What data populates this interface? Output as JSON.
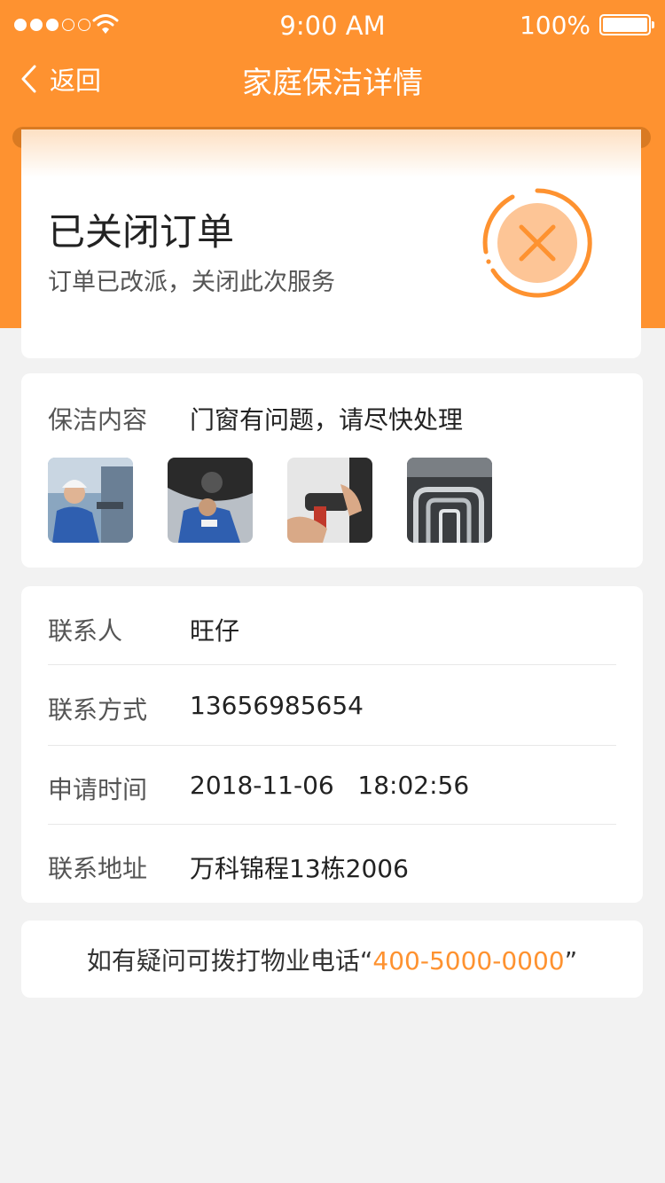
{
  "status_bar": {
    "time": "9:00 AM",
    "battery": "100%"
  },
  "nav": {
    "back_label": "返回",
    "title": "家庭保洁详情"
  },
  "order_status": {
    "title": "已关闭订单",
    "subtitle": "订单已改派，关闭此次服务",
    "icon": "close-icon"
  },
  "cleaning": {
    "label": "保洁内容",
    "value": "门窗有问题，请尽快处理",
    "photos": [
      "worker-photo",
      "car-underside-photo",
      "impact-wrench-photo",
      "pipes-photo"
    ]
  },
  "contact": {
    "rows": [
      {
        "label": "联系人",
        "value": "旺仔"
      },
      {
        "label": "联系方式",
        "value": "13656985654"
      },
      {
        "label": "申请时间",
        "value": "2018-11-06   18:02:56"
      },
      {
        "label": "联系地址",
        "value": "万科锦程13栋2006"
      }
    ]
  },
  "help": {
    "prefix": "如有疑问可拨打物业电话“",
    "phone": "400-5000-0000",
    "suffix": "”"
  },
  "colors": {
    "accent": "#fe9230",
    "background": "#f2f2f2"
  }
}
